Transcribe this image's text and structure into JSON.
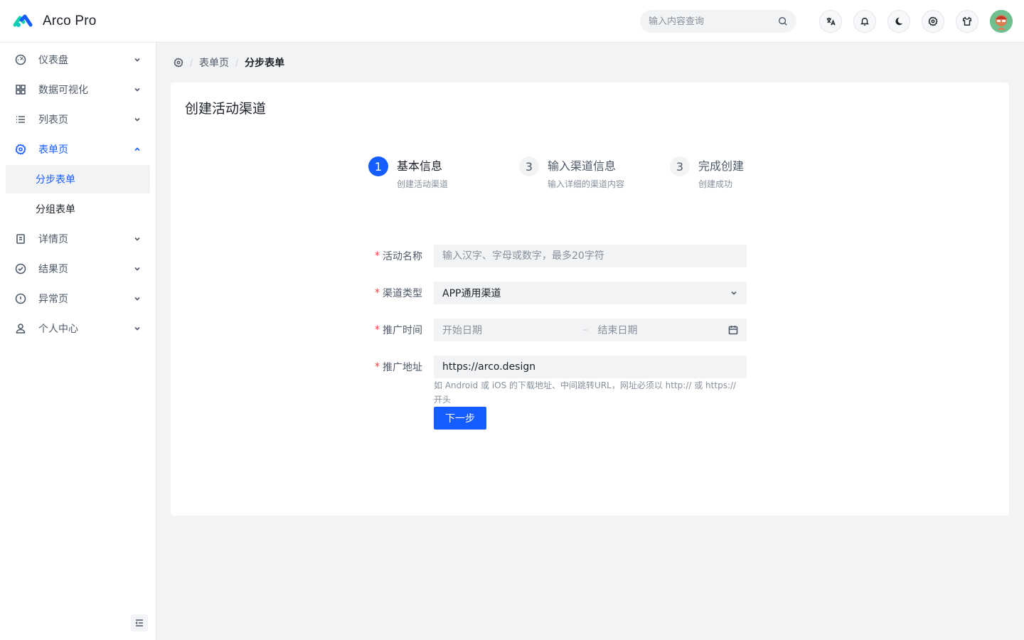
{
  "header": {
    "app_name": "Arco Pro",
    "search_placeholder": "输入内容查询",
    "icons": [
      "language-icon",
      "bell-icon",
      "moon-icon",
      "settings-icon",
      "shirt-icon"
    ]
  },
  "sidebar": {
    "items": [
      {
        "label": "仪表盘",
        "icon": "dashboard-icon"
      },
      {
        "label": "数据可视化",
        "icon": "apps-icon"
      },
      {
        "label": "列表页",
        "icon": "list-icon"
      },
      {
        "label": "表单页",
        "icon": "settings-icon"
      },
      {
        "label": "详情页",
        "icon": "file-icon"
      },
      {
        "label": "结果页",
        "icon": "check-circle-icon"
      },
      {
        "label": "异常页",
        "icon": "exclamation-circle-icon"
      },
      {
        "label": "个人中心",
        "icon": "user-icon"
      }
    ],
    "form_subitems": [
      {
        "label": "分步表单"
      },
      {
        "label": "分组表单"
      }
    ]
  },
  "breadcrumb": {
    "items": [
      "表单页",
      "分步表单"
    ],
    "separator": "/"
  },
  "page": {
    "title": "创建活动渠道"
  },
  "steps": [
    {
      "num": "1",
      "title": "基本信息",
      "desc": "创建活动渠道",
      "status": "active"
    },
    {
      "num": "3",
      "title": "输入渠道信息",
      "desc": "输入详细的渠道内容",
      "status": "wait"
    },
    {
      "num": "3",
      "title": "完成创建",
      "desc": "创建成功",
      "status": "wait"
    }
  ],
  "form": {
    "required_mark": "*",
    "activity_name": {
      "label": "活动名称",
      "placeholder": "输入汉字、字母或数字，最多20字符",
      "value": ""
    },
    "channel_type": {
      "label": "渠道类型",
      "value": "APP通用渠道"
    },
    "promo_time": {
      "label": "推广时间",
      "start_placeholder": "开始日期",
      "separator": "–",
      "end_placeholder": "结束日期"
    },
    "promo_url": {
      "label": "推广地址",
      "value": "https://arco.design",
      "help": "如 Android 或 iOS 的下载地址、中间跳转URL，网址必须以 http:// 或 https:// 开头"
    },
    "next_button": "下一步"
  },
  "colors": {
    "primary": "#165dff",
    "required": "#f53f3f",
    "bg": "#f2f3f5"
  }
}
